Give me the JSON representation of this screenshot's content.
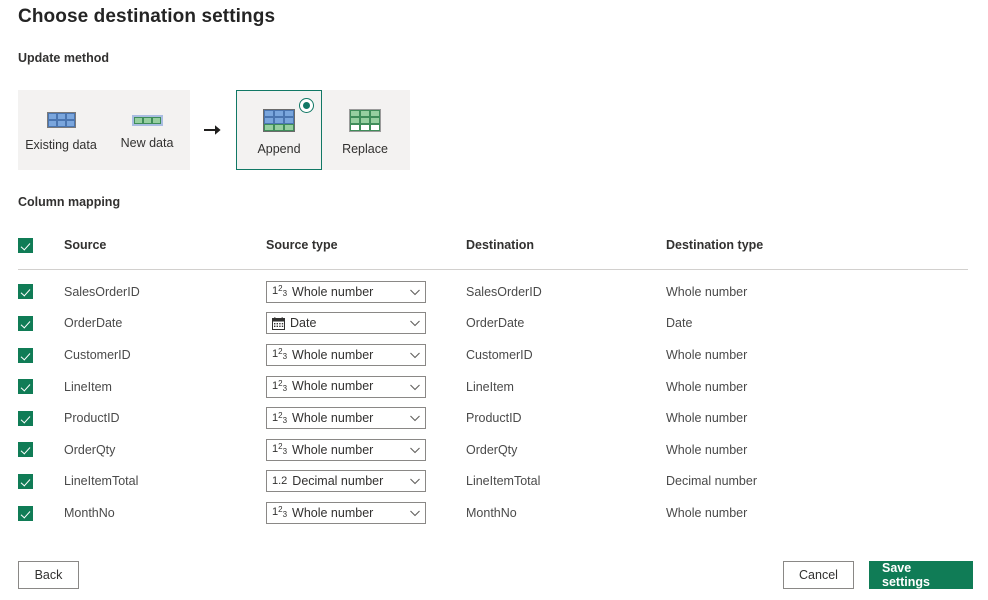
{
  "page": {
    "title": "Choose destination settings"
  },
  "update_method": {
    "label": "Update method",
    "arrow_icon": "arrow-right-icon",
    "source_tiles": [
      {
        "label": "Existing data",
        "icon": "table-existing-data-icon",
        "selected": false
      },
      {
        "label": "New data",
        "icon": "table-new-data-icon",
        "selected": false
      }
    ],
    "target_tiles": [
      {
        "label": "Append",
        "icon": "table-append-icon",
        "selected": true
      },
      {
        "label": "Replace",
        "icon": "table-replace-icon",
        "selected": false
      }
    ],
    "selected_value": "Append"
  },
  "column_mapping": {
    "label": "Column mapping",
    "header": {
      "select_all_checked": true,
      "source": "Source",
      "source_type": "Source type",
      "destination": "Destination",
      "destination_type": "Destination type"
    },
    "rows": [
      {
        "checked": true,
        "source": "SalesOrderID",
        "source_type": "Whole number",
        "source_type_icon": "whole-number-icon",
        "destination": "SalesOrderID",
        "destination_type": "Whole number"
      },
      {
        "checked": true,
        "source": "OrderDate",
        "source_type": "Date",
        "source_type_icon": "calendar-icon",
        "destination": "OrderDate",
        "destination_type": "Date"
      },
      {
        "checked": true,
        "source": "CustomerID",
        "source_type": "Whole number",
        "source_type_icon": "whole-number-icon",
        "destination": "CustomerID",
        "destination_type": "Whole number"
      },
      {
        "checked": true,
        "source": "LineItem",
        "source_type": "Whole number",
        "source_type_icon": "whole-number-icon",
        "destination": "LineItem",
        "destination_type": "Whole number"
      },
      {
        "checked": true,
        "source": "ProductID",
        "source_type": "Whole number",
        "source_type_icon": "whole-number-icon",
        "destination": "ProductID",
        "destination_type": "Whole number"
      },
      {
        "checked": true,
        "source": "OrderQty",
        "source_type": "Whole number",
        "source_type_icon": "whole-number-icon",
        "destination": "OrderQty",
        "destination_type": "Whole number"
      },
      {
        "checked": true,
        "source": "LineItemTotal",
        "source_type": "Decimal number",
        "source_type_icon": "decimal-number-icon",
        "destination": "LineItemTotal",
        "destination_type": "Decimal number"
      },
      {
        "checked": true,
        "source": "MonthNo",
        "source_type": "Whole number",
        "source_type_icon": "whole-number-icon",
        "destination": "MonthNo",
        "destination_type": "Whole number"
      }
    ]
  },
  "footer": {
    "back_label": "Back",
    "cancel_label": "Cancel",
    "save_label": "Save settings"
  },
  "colors": {
    "accent_green": "#107c56",
    "selected_border": "#117865",
    "panel_bg": "#f3f2f1",
    "text": "#323130",
    "border": "#8a8886"
  }
}
